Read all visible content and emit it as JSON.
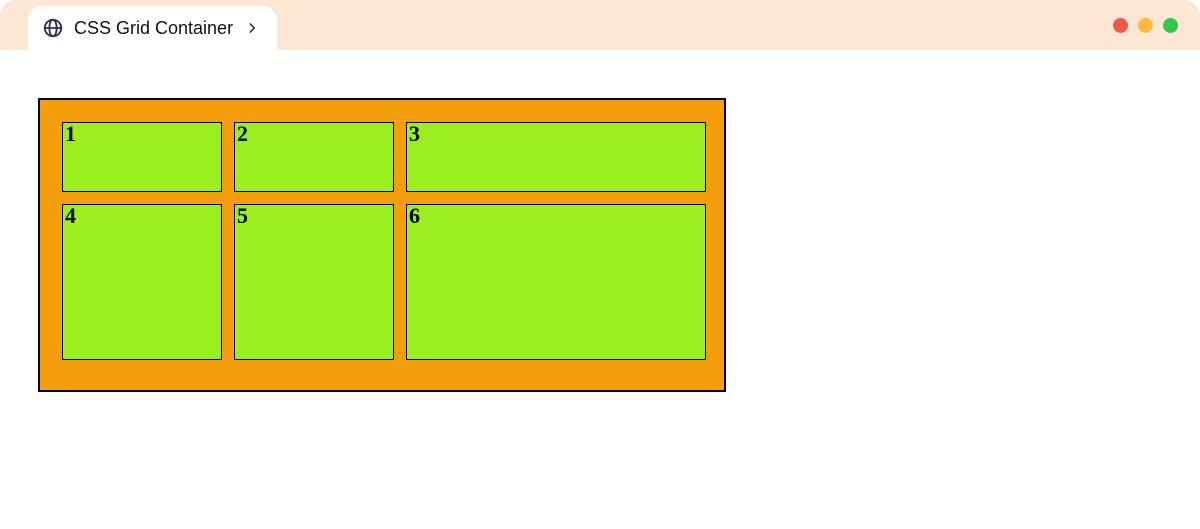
{
  "tab": {
    "title": "CSS Grid Container",
    "icon": "globe-icon",
    "chevron": "chevron-right-icon"
  },
  "window_controls": {
    "close": "close",
    "minimize": "minimize",
    "maximize": "maximize"
  },
  "grid": {
    "columns": [
      "160px",
      "160px",
      "300px"
    ],
    "rows": [
      "70px",
      "156px"
    ],
    "container_bg": "#f59e0b",
    "cell_bg": "#9bef1f",
    "cells": [
      "1",
      "2",
      "3",
      "4",
      "5",
      "6"
    ]
  }
}
